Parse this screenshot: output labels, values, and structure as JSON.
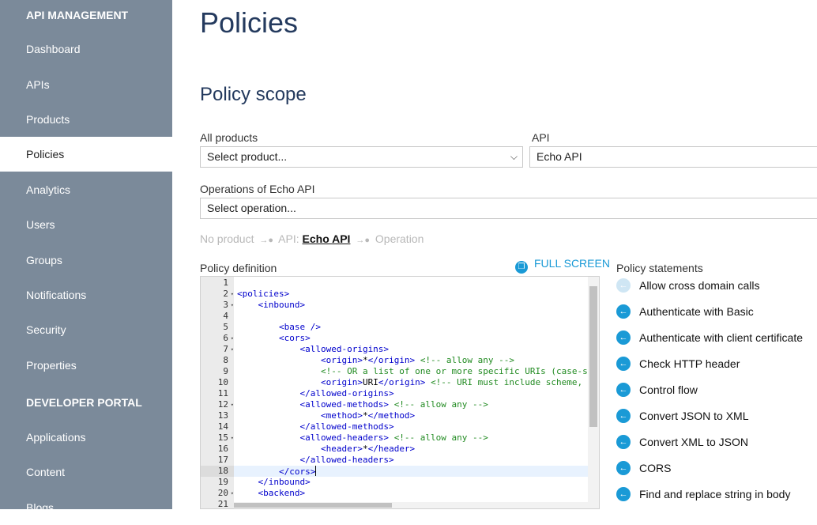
{
  "sidebar": {
    "section1": "API MANAGEMENT",
    "items1": [
      {
        "label": "Dashboard"
      },
      {
        "label": "APIs"
      },
      {
        "label": "Products"
      },
      {
        "label": "Policies"
      },
      {
        "label": "Analytics"
      },
      {
        "label": "Users"
      },
      {
        "label": "Groups"
      },
      {
        "label": "Notifications"
      },
      {
        "label": "Security"
      },
      {
        "label": "Properties"
      }
    ],
    "section2": "DEVELOPER PORTAL",
    "items2": [
      {
        "label": "Applications"
      },
      {
        "label": "Content"
      },
      {
        "label": "Blogs"
      }
    ],
    "active": "Policies"
  },
  "page": {
    "title": "Policies",
    "scope_title": "Policy scope"
  },
  "scope": {
    "products_label": "All products",
    "products_value": "Select product...",
    "api_label": "API",
    "api_value": "Echo API",
    "operations_label": "Operations of Echo API",
    "operations_value": "Select operation..."
  },
  "breadcrumb": {
    "item1": "No product",
    "item2_prefix": "API:",
    "item2_value": "Echo API",
    "item3": "Operation"
  },
  "editor": {
    "label": "Policy definition",
    "fullscreen": "FULL SCREEN",
    "current_line": 18,
    "lines": [
      {
        "n": "1",
        "text": ""
      },
      {
        "n": "2",
        "text": "<policies>"
      },
      {
        "n": "3",
        "text": "    <inbound>"
      },
      {
        "n": "4",
        "text": ""
      },
      {
        "n": "5",
        "text": "        <base />"
      },
      {
        "n": "6",
        "text": "        <cors>"
      },
      {
        "n": "7",
        "text": "            <allowed-origins>"
      },
      {
        "n": "8",
        "text": "                <origin>*</origin> <!-- allow any -->"
      },
      {
        "n": "9",
        "text": "                <!-- OR a list of one or more specific URIs (case-s"
      },
      {
        "n": "10",
        "text": "                <origin>URI</origin> <!-- URI must include scheme, "
      },
      {
        "n": "11",
        "text": "            </allowed-origins>"
      },
      {
        "n": "12",
        "text": "            <allowed-methods> <!-- allow any -->"
      },
      {
        "n": "13",
        "text": "                <method>*</method>"
      },
      {
        "n": "14",
        "text": "            </allowed-methods>"
      },
      {
        "n": "15",
        "text": "            <allowed-headers> <!-- allow any -->"
      },
      {
        "n": "16",
        "text": "                <header>*</header>"
      },
      {
        "n": "17",
        "text": "            </allowed-headers>"
      },
      {
        "n": "18",
        "text": "        </cors>"
      },
      {
        "n": "19",
        "text": "    </inbound>"
      },
      {
        "n": "20",
        "text": "    <backend>"
      },
      {
        "n": "21",
        "text": ""
      }
    ],
    "foldable": [
      "2",
      "3",
      "6",
      "7",
      "12",
      "15",
      "20"
    ]
  },
  "statements": {
    "title": "Policy statements",
    "items": [
      {
        "label": "Allow cross domain calls",
        "enabled": false
      },
      {
        "label": "Authenticate with Basic",
        "enabled": true
      },
      {
        "label": "Authenticate with client certificate",
        "enabled": true
      },
      {
        "label": "Check HTTP header",
        "enabled": true
      },
      {
        "label": "Control flow",
        "enabled": true
      },
      {
        "label": "Convert JSON to XML",
        "enabled": true
      },
      {
        "label": "Convert XML to JSON",
        "enabled": true
      },
      {
        "label": "CORS",
        "enabled": true
      },
      {
        "label": "Find and replace string in body",
        "enabled": true
      }
    ]
  },
  "colors": {
    "sidebar_bg": "#7b8a9a",
    "accent": "#1a9ad6",
    "title": "#243a5e"
  },
  "icons": {
    "statement": "arrow-left-circle-icon",
    "fullscreen": "fullscreen-icon",
    "dropdown": "chevron-down-icon"
  }
}
